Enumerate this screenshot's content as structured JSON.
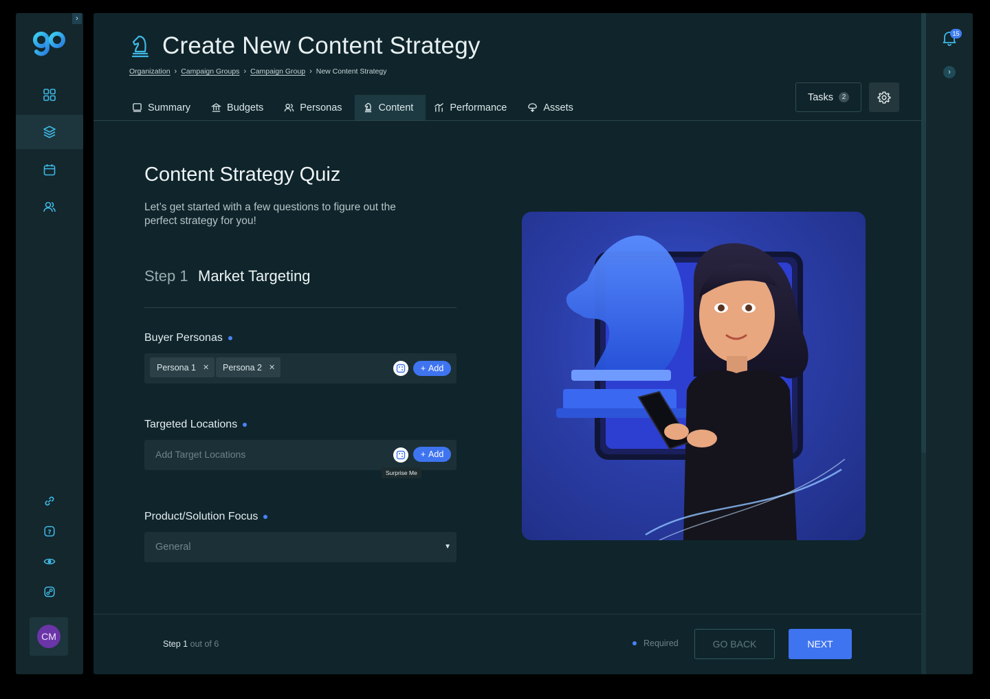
{
  "sidebar": {
    "expand_icon": "chevron-right-icon",
    "logo": "gp",
    "items": [
      {
        "icon": "grid-icon"
      },
      {
        "icon": "layers-icon"
      },
      {
        "icon": "calendar-icon"
      },
      {
        "icon": "users-icon"
      }
    ],
    "bottom_items": [
      {
        "icon": "link-icon"
      },
      {
        "icon": "help-icon"
      },
      {
        "icon": "eye-icon"
      },
      {
        "icon": "share-icon"
      }
    ],
    "avatar_initials": "CM"
  },
  "header": {
    "title": "Create New Content Strategy",
    "icon": "chess-knight-icon",
    "breadcrumb": [
      "Organization",
      "Campaign Groups",
      "Campaign Group",
      "New Content Strategy"
    ]
  },
  "tabs": [
    {
      "label": "Summary",
      "icon": "summary-icon"
    },
    {
      "label": "Budgets",
      "icon": "bank-icon"
    },
    {
      "label": "Personas",
      "icon": "personas-icon"
    },
    {
      "label": "Content",
      "icon": "chess-knight-icon",
      "active": true
    },
    {
      "label": "Performance",
      "icon": "performance-icon"
    },
    {
      "label": "Assets",
      "icon": "assets-icon"
    }
  ],
  "toolbar": {
    "tasks_label": "Tasks",
    "tasks_count": "2",
    "settings_icon": "gear-icon"
  },
  "notifications": {
    "count": "15",
    "icon": "bell-icon"
  },
  "quiz": {
    "title": "Content Strategy Quiz",
    "subtitle": "Let’s get started with a few questions to figure out the perfect strategy for you!",
    "step_label": "Step 1",
    "step_name": "Market Targeting"
  },
  "fields": {
    "buyer_personas": {
      "label": "Buyer Personas",
      "chips": [
        "Persona 1",
        "Persona 2"
      ],
      "add_label": "Add"
    },
    "targeted_locations": {
      "label": "Targeted Locations",
      "placeholder": "Add Target Locations",
      "add_label": "Add",
      "tooltip": "Surprise Me"
    },
    "product_focus": {
      "label": "Product/Solution Focus",
      "value": "General"
    }
  },
  "footer": {
    "step_text": "Step 1",
    "step_total": "out of 6",
    "required_label": "Required",
    "back_label": "GO BACK",
    "next_label": "NEXT"
  },
  "colors": {
    "accent": "#3f74f0",
    "background": "#0f252b",
    "rail": "#13272d",
    "brand_logo": "#2ab7e6"
  }
}
